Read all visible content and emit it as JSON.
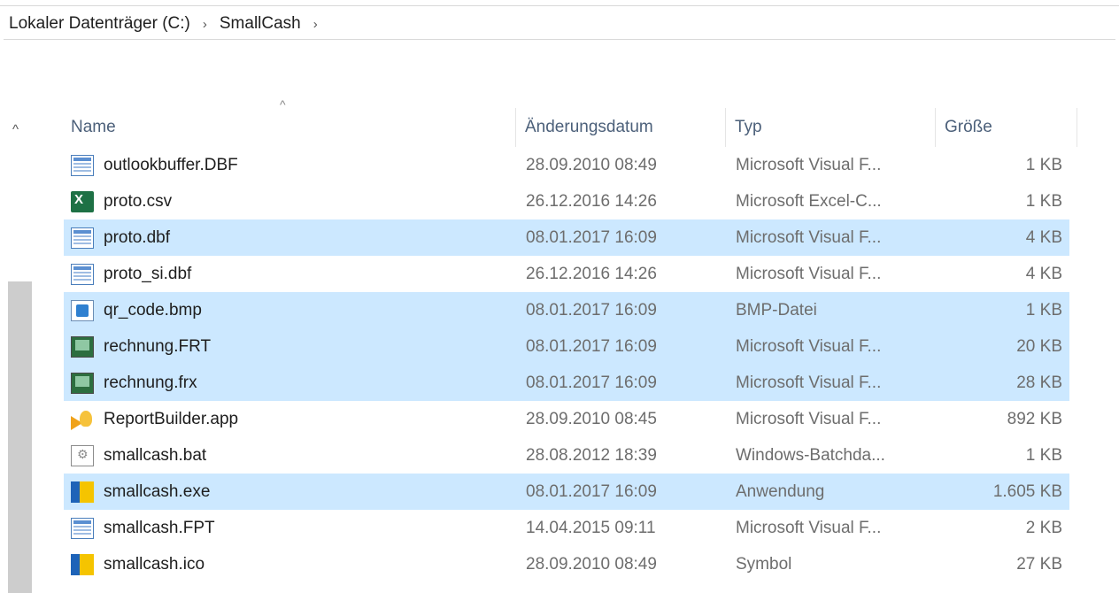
{
  "breadcrumb": {
    "items": [
      "Lokaler Datenträger (C:)",
      "SmallCash"
    ],
    "separator": "›"
  },
  "columns": {
    "name": "Name",
    "date": "Änderungsdatum",
    "type": "Typ",
    "size": "Größe"
  },
  "colors": {
    "selected_row": "#cce8ff",
    "header_text": "#4c607a",
    "meta_text": "#6d6d6d"
  },
  "files": [
    {
      "name": "outlookbuffer.DBF",
      "date": "28.09.2010 08:49",
      "type": "Microsoft Visual F...",
      "size": "1 KB",
      "icon": "dbf-table-icon",
      "selected": false
    },
    {
      "name": "proto.csv",
      "date": "26.12.2016 14:26",
      "type": "Microsoft Excel-C...",
      "size": "1 KB",
      "icon": "excel-csv-icon",
      "selected": false
    },
    {
      "name": "proto.dbf",
      "date": "08.01.2017 16:09",
      "type": "Microsoft Visual F...",
      "size": "4 KB",
      "icon": "dbf-table-icon",
      "selected": true
    },
    {
      "name": "proto_si.dbf",
      "date": "26.12.2016 14:26",
      "type": "Microsoft Visual F...",
      "size": "4 KB",
      "icon": "dbf-table-icon",
      "selected": false
    },
    {
      "name": "qr_code.bmp",
      "date": "08.01.2017 16:09",
      "type": "BMP-Datei",
      "size": "1 KB",
      "icon": "bitmap-image-icon",
      "selected": true
    },
    {
      "name": "rechnung.FRT",
      "date": "08.01.2017 16:09",
      "type": "Microsoft Visual F...",
      "size": "20 KB",
      "icon": "report-form-icon",
      "selected": true
    },
    {
      "name": "rechnung.frx",
      "date": "08.01.2017 16:09",
      "type": "Microsoft Visual F...",
      "size": "28 KB",
      "icon": "report-form-icon",
      "selected": true
    },
    {
      "name": "ReportBuilder.app",
      "date": "28.09.2010 08:45",
      "type": "Microsoft Visual F...",
      "size": "892 KB",
      "icon": "foxpro-app-icon",
      "selected": false
    },
    {
      "name": "smallcash.bat",
      "date": "28.08.2012 18:39",
      "type": "Windows-Batchda...",
      "size": "1 KB",
      "icon": "batch-file-icon",
      "selected": false
    },
    {
      "name": "smallcash.exe",
      "date": "08.01.2017 16:09",
      "type": "Anwendung",
      "size": "1.605 KB",
      "icon": "application-exe-icon",
      "selected": true
    },
    {
      "name": "smallcash.FPT",
      "date": "14.04.2015 09:11",
      "type": "Microsoft Visual F...",
      "size": "2 KB",
      "icon": "dbf-table-icon",
      "selected": false
    },
    {
      "name": "smallcash.ico",
      "date": "28.09.2010 08:49",
      "type": "Symbol",
      "size": "27 KB",
      "icon": "application-exe-icon",
      "selected": false
    }
  ]
}
